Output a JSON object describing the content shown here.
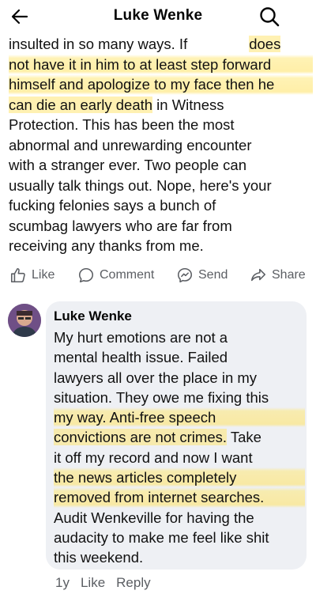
{
  "header": {
    "title": "Luke Wenke"
  },
  "post": {
    "lines": [
      "insulted in so many ways.  If",
      "does",
      "not have it in him to at least step forward",
      "himself and apologize to my face then he",
      "can die an early death",
      " in Witness",
      "Protection.  This has been the most",
      "abnormal and unrewarding encounter",
      "with a stranger ever.  Two people can",
      "usually talk things out.  Nope, here's your",
      "fucking felonies says a bunch of",
      "scumbag lawyers who are far from",
      "receiving any thanks from me."
    ]
  },
  "actions": {
    "like": "Like",
    "comment": "Comment",
    "send": "Send",
    "share": "Share"
  },
  "comment": {
    "author": "Luke Wenke",
    "lines": [
      "My hurt emotions are not a",
      "mental health issue.  Failed",
      "lawyers all over the place in my",
      "situation.  They owe me fixing this",
      "my way.  Anti-free speech",
      "convictions are not crimes.",
      "  Take",
      "it off my record and now I want",
      "the news articles completely",
      "removed from internet searches.",
      "Audit Wenkeville for having the",
      "audacity to make me feel like shit",
      "this weekend."
    ],
    "time": "1y",
    "like": "Like",
    "reply": "Reply"
  },
  "colors": {
    "highlight": "#ffe674",
    "comment_bg": "#eef0f4",
    "secondary_text": "#5b5e63"
  }
}
